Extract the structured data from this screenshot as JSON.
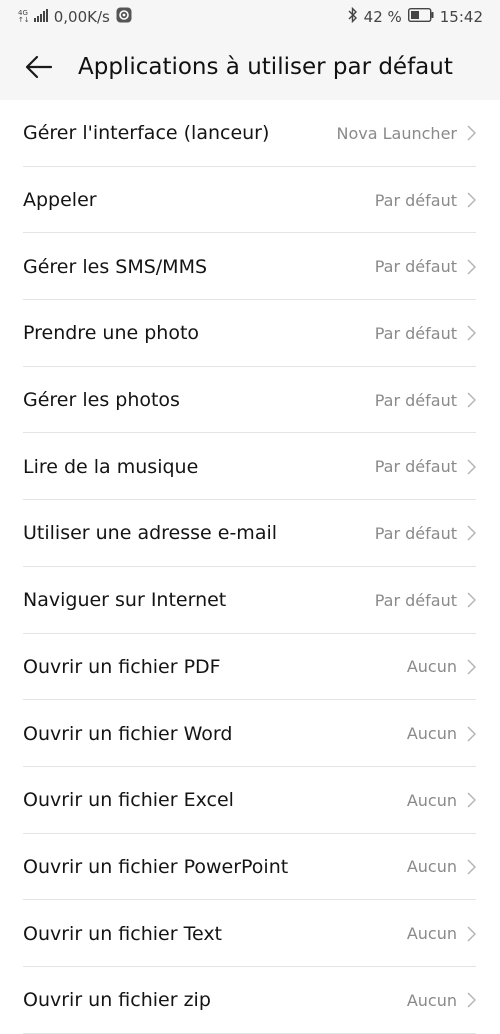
{
  "status_bar": {
    "network_type": "4G",
    "network_sub": "↑↓",
    "speed": "0,00K/s",
    "battery_percent": "42 %",
    "time": "15:42",
    "icons": [
      "signal-icon",
      "app-notification-icon",
      "bluetooth-icon",
      "battery-icon"
    ]
  },
  "header": {
    "title": "Applications à utiliser par défaut",
    "back_icon": "arrow-left-icon"
  },
  "items": [
    {
      "label": "Gérer l'interface (lanceur)",
      "value": "Nova Launcher"
    },
    {
      "label": "Appeler",
      "value": "Par défaut"
    },
    {
      "label": "Gérer les SMS/MMS",
      "value": "Par défaut"
    },
    {
      "label": "Prendre une photo",
      "value": "Par défaut"
    },
    {
      "label": "Gérer les photos",
      "value": "Par défaut"
    },
    {
      "label": "Lire de la musique",
      "value": "Par défaut"
    },
    {
      "label": "Utiliser une adresse e-mail",
      "value": "Par défaut"
    },
    {
      "label": "Naviguer sur Internet",
      "value": "Par défaut"
    },
    {
      "label": "Ouvrir un fichier PDF",
      "value": "Aucun"
    },
    {
      "label": "Ouvrir un fichier Word",
      "value": "Aucun"
    },
    {
      "label": "Ouvrir un fichier Excel",
      "value": "Aucun"
    },
    {
      "label": "Ouvrir un fichier PowerPoint",
      "value": "Aucun"
    },
    {
      "label": "Ouvrir un fichier Text",
      "value": "Aucun"
    },
    {
      "label": "Ouvrir un fichier zip",
      "value": "Aucun"
    }
  ],
  "colors": {
    "header_bg": "#f6f6f6",
    "label": "#141414",
    "value": "#8a8a8a",
    "divider": "#e4e4e4"
  }
}
